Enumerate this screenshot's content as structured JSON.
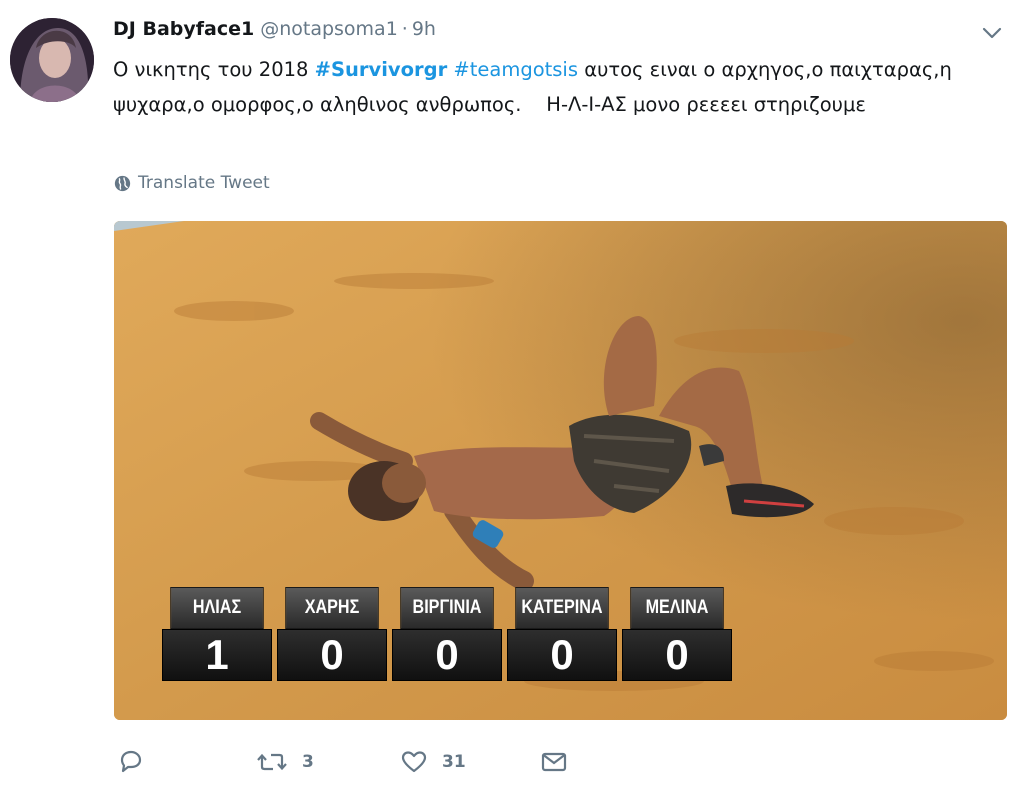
{
  "tweet": {
    "display_name": "DJ Babyface1",
    "handle": "@notapsoma1",
    "separator": "·",
    "time": "9h",
    "text_part1": "Ο νικητης του 2018 ",
    "hashtag1": "#Survivorgr",
    "text_space": " ",
    "hashtag2": "#teamgotsis",
    "text_part2": " αυτος ειναι ο αρχηγος,ο παιχταρας,η ψυχαρα,ο ομορφος,ο αληθινος ανθρωπος.    Η-Λ-Ι-ΑΣ μονο ρεεεει στηριζουμε",
    "translate_label": "Translate Tweet"
  },
  "scoreboard": [
    {
      "name": "ΗΛΙΑΣ",
      "score": "1"
    },
    {
      "name": "ΧΑΡΗΣ",
      "score": "0"
    },
    {
      "name": "ΒΙΡΓΙΝΙΑ",
      "score": "0"
    },
    {
      "name": "ΚΑΤΕΡΙΝΑ",
      "score": "0"
    },
    {
      "name": "ΜΕΛΙΝΑ",
      "score": "0"
    }
  ],
  "actions": {
    "reply_icon": "reply-icon",
    "retweet_icon": "retweet-icon",
    "retweet_count": "3",
    "like_icon": "heart-icon",
    "like_count": "31",
    "dm_icon": "envelope-icon"
  },
  "colors": {
    "link": "#1b95e0",
    "muted": "#657786",
    "text": "#14171a",
    "sand": "#d49a4a"
  }
}
